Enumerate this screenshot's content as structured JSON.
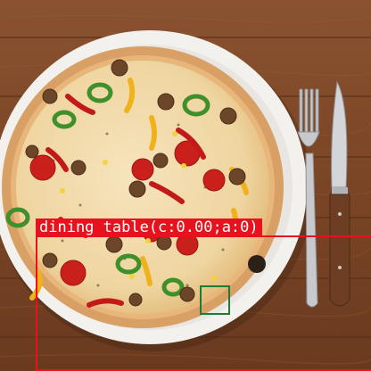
{
  "image": {
    "subject": "pizza on a white plate with fork and knife on a wooden table",
    "colors": {
      "wood": "#7a4526",
      "plate": "#f3f1ee",
      "crust": "#d9a066",
      "cheese": "#f2dcae",
      "tomato": "#c9201c",
      "pepper_green": "#3f8f2a",
      "pepper_yellow": "#f0b21c",
      "meatball": "#6b4628",
      "olive_dark": "#2b2118"
    }
  },
  "detections": [
    {
      "label": "dining table(c:0.00;a:0)",
      "color": "#e8121e"
    },
    {
      "label": "",
      "color": "#1f7a3a"
    }
  ]
}
